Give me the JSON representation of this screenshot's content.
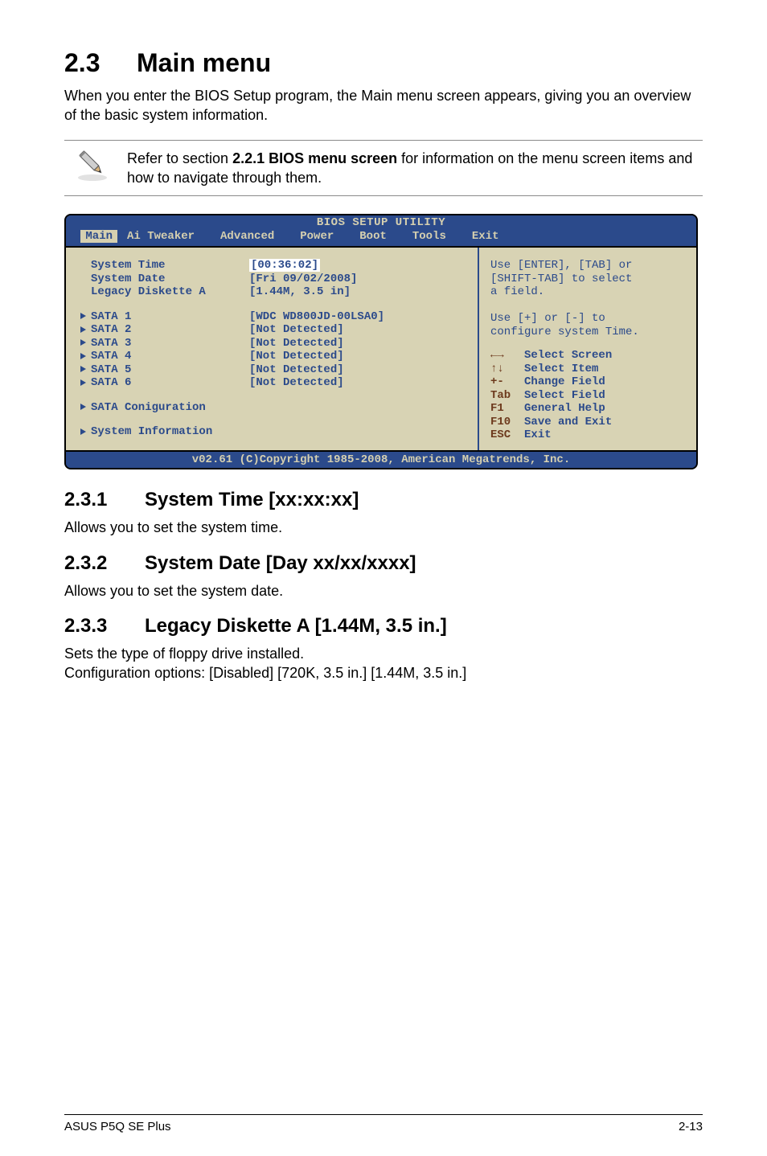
{
  "heading": {
    "num": "2.3",
    "title": "Main menu"
  },
  "intro": "When you enter the BIOS Setup program, the Main menu screen appears, giving you an overview of the basic system information.",
  "note": {
    "preText": "Refer to section ",
    "boldText": "2.2.1  BIOS menu screen",
    "postText": " for information on the menu screen items and how to navigate through them."
  },
  "bios": {
    "titlebar": "BIOS SETUP UTILITY",
    "tabs": [
      "Main",
      "Ai Tweaker",
      "Advanced",
      "Power",
      "Boot",
      "Tools",
      "Exit"
    ],
    "selectedTab": "Main",
    "rows": [
      {
        "label": "System Time",
        "value": "[00:36:02]",
        "selected": true,
        "arrow": false
      },
      {
        "label": "System Date",
        "value": "[Fri 09/02/2008]",
        "arrow": false
      },
      {
        "label": "Legacy Diskette A",
        "value": "[1.44M, 3.5 in]",
        "arrow": false
      },
      {
        "spacer": true
      },
      {
        "label": "SATA 1",
        "value": "[WDC WD800JD-00LSA0]",
        "arrow": true
      },
      {
        "label": "SATA 2",
        "value": "[Not Detected]",
        "arrow": true
      },
      {
        "label": "SATA 3",
        "value": "[Not Detected]",
        "arrow": true
      },
      {
        "label": "SATA 4",
        "value": "[Not Detected]",
        "arrow": true
      },
      {
        "label": "SATA 5",
        "value": "[Not Detected]",
        "arrow": true
      },
      {
        "label": "SATA 6",
        "value": "[Not Detected]",
        "arrow": true
      },
      {
        "spacer": true
      },
      {
        "label": "SATA Coniguration",
        "value": "",
        "arrow": true
      },
      {
        "spacer": true
      },
      {
        "label": "System Information",
        "value": "",
        "arrow": true
      }
    ],
    "help": [
      "Use [ENTER], [TAB] or",
      "[SHIFT-TAB] to select",
      "a field.",
      "",
      "Use [+] or [-] to",
      "configure system Time."
    ],
    "keys": [
      {
        "sym": "←→",
        "label": "Select Screen"
      },
      {
        "sym": "↑↓",
        "label": "Select Item"
      },
      {
        "sym": "+-",
        "label": "Change Field"
      },
      {
        "sym": "Tab",
        "label": "Select Field"
      },
      {
        "sym": "F1",
        "label": "General Help"
      },
      {
        "sym": "F10",
        "label": "Save and Exit"
      },
      {
        "sym": "ESC",
        "label": "Exit"
      }
    ],
    "copyright": "v02.61 (C)Copyright 1985-2008, American Megatrends, Inc."
  },
  "subsections": [
    {
      "num": "2.3.1",
      "title": "System Time [xx:xx:xx]",
      "body": "Allows you to set the system time."
    },
    {
      "num": "2.3.2",
      "title": "System Date [Day xx/xx/xxxx]",
      "body": "Allows you to set the system date."
    },
    {
      "num": "2.3.3",
      "title": "Legacy Diskette A [1.44M, 3.5 in.]",
      "body_lines": [
        "Sets the type of floppy drive installed.",
        "Configuration options: [Disabled] [720K, 3.5 in.] [1.44M, 3.5 in.]"
      ]
    }
  ],
  "footer": {
    "left": "ASUS P5Q SE Plus",
    "right": "2-13"
  }
}
